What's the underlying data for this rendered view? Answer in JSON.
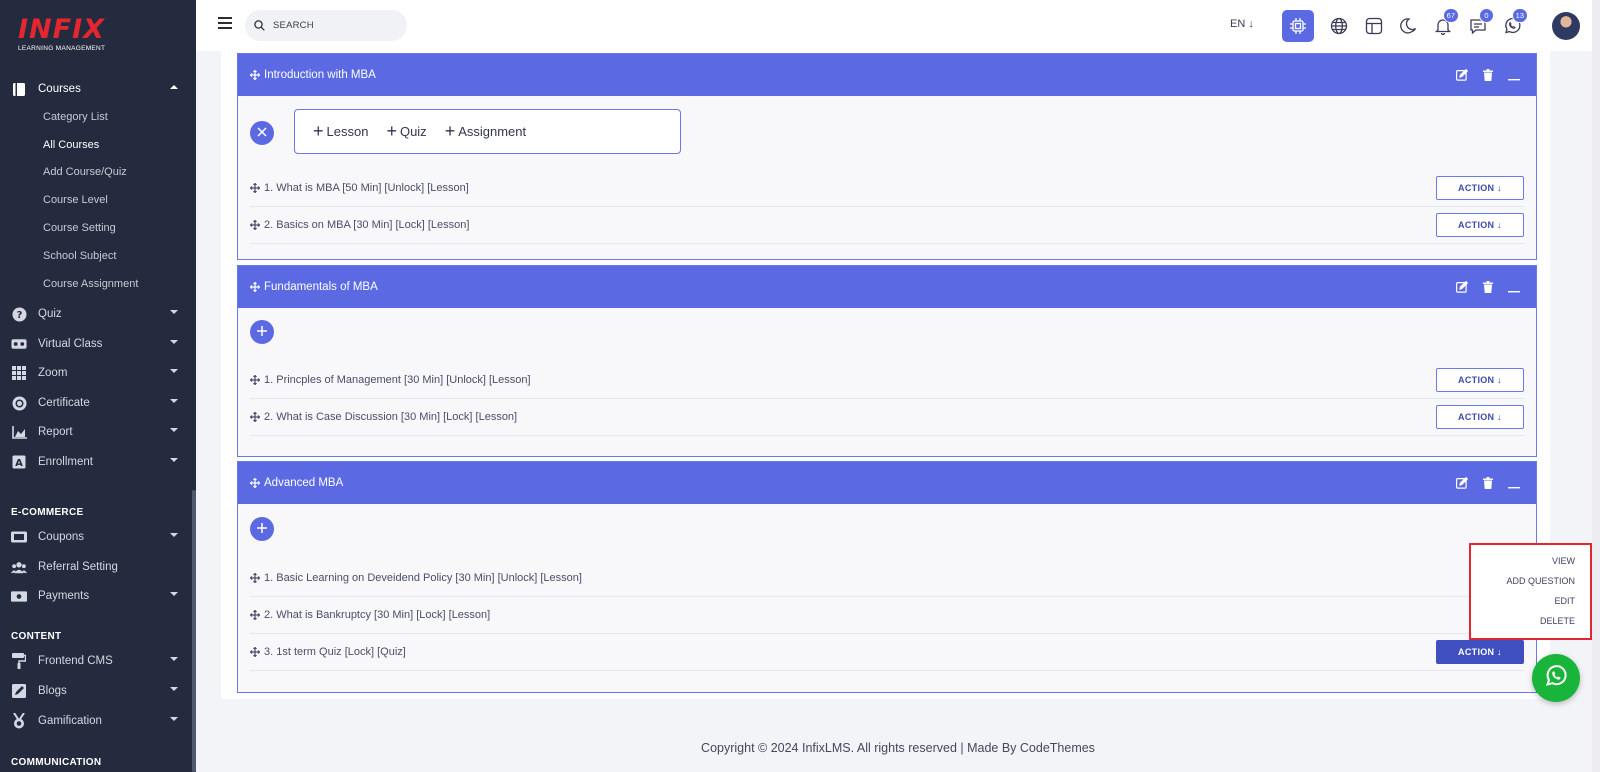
{
  "brand": {
    "logo": "INFIX",
    "tagline": "LEARNING MANAGEMENT",
    "accent": "#5b6ae3",
    "logo_color": "#e3262f"
  },
  "header": {
    "search_placeholder": "SEARCH",
    "language": "EN ↓",
    "badges": {
      "notifications": "67",
      "messages": "0",
      "whatsapp": "13"
    }
  },
  "sidebar": {
    "courses": "Courses",
    "courses_sub": [
      "Category List",
      "All Courses",
      "Add Course/Quiz",
      "Course Level",
      "Course Setting",
      "School Subject",
      "Course Assignment"
    ],
    "menu": [
      "Quiz",
      "Virtual Class",
      "Zoom",
      "Certificate",
      "Report",
      "Enrollment"
    ],
    "ecommerce_label": "E-COMMERCE",
    "ecommerce": [
      "Coupons",
      "Referral Setting",
      "Payments"
    ],
    "content_label": "CONTENT",
    "content": [
      "Frontend CMS",
      "Blogs",
      "Gamification"
    ],
    "communication_label": "COMMUNICATION"
  },
  "add_panel": {
    "lesson": "Lesson",
    "quiz": "Quiz",
    "assignment": "Assignment"
  },
  "chapters": [
    {
      "title": "Introduction with MBA",
      "lessons": [
        "1. What is MBA [50 Min] [Unlock] [Lesson]",
        "2. Basics on MBA [30 Min] [Lock] [Lesson]"
      ]
    },
    {
      "title": "Fundamentals of MBA",
      "lessons": [
        "1. Princples of Management [30 Min] [Unlock] [Lesson]",
        "2. What is Case Discussion [30 Min] [Lock] [Lesson]"
      ]
    },
    {
      "title": "Advanced MBA",
      "lessons": [
        "1. Basic Learning on Deveidend Policy [30 Min] [Unlock] [Lesson]",
        "2. What is Bankruptcy [30 Min] [Lock] [Lesson]",
        "3. 1st term Quiz [Lock] [Quiz]"
      ]
    }
  ],
  "action_label": "ACTION ↓",
  "dropdown": [
    "VIEW",
    "ADD QUESTION",
    "EDIT",
    "DELETE"
  ],
  "footer": "Copyright © 2024 InfixLMS. All rights reserved | Made By CodeThemes"
}
